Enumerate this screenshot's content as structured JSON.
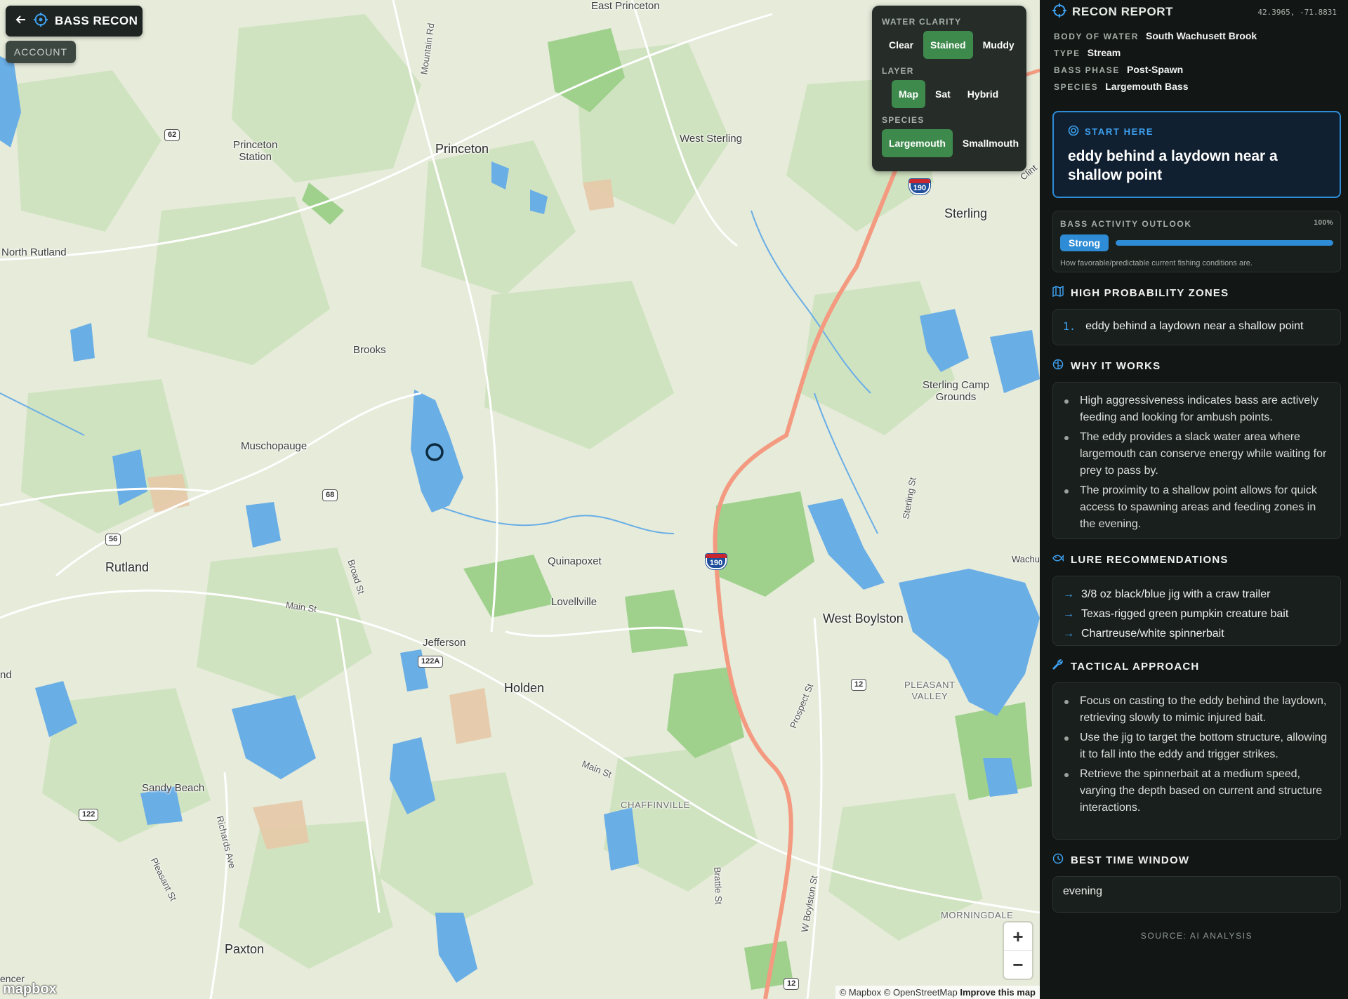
{
  "app": {
    "brand": "BASS RECON",
    "account_label": "ACCOUNT"
  },
  "filters": {
    "water_clarity": {
      "title": "WATER CLARITY",
      "options": [
        "Clear",
        "Stained",
        "Muddy"
      ],
      "selected": "Stained"
    },
    "layer": {
      "title": "LAYER",
      "options": [
        "Map",
        "Sat",
        "Hybrid"
      ],
      "selected": "Map"
    },
    "species": {
      "title": "SPECIES",
      "options": [
        "Largemouth",
        "Smallmouth"
      ],
      "selected": "Largemouth"
    }
  },
  "map": {
    "places": {
      "east_princeton": "East Princeton",
      "princeton_station": "Princeton\nStation",
      "princeton": "Princeton",
      "west_sterling": "West Sterling",
      "sterling": "Sterling",
      "north_rutland": "North Rutland",
      "brooks": "Brooks",
      "muschopauge": "Muschopauge",
      "sterling_camp_grounds": "Sterling Camp\nGrounds",
      "rutland": "Rutland",
      "quinapoxet": "Quinapoxet",
      "lovellville": "Lovellville",
      "jefferson": "Jefferson",
      "holden": "Holden",
      "west_boylston": "West Boylston",
      "pleasant_valley": "PLEASANT\nVALLEY",
      "chaffinville": "CHAFFINVILLE",
      "sandy_beach": "Sandy Beach",
      "morningdale": "MORNINGDALE",
      "paxton": "Paxton",
      "wachu": "Wachu",
      "clint": "Clint",
      "nd": "nd",
      "encer": "encer"
    },
    "roads": {
      "mountain_rd": "Mountain Rd",
      "main_st_1": "Main St",
      "main_st_2": "Main St",
      "broad_st": "Broad St",
      "sterling_st": "Sterling St",
      "prospect_st": "Prospect St",
      "richards_ave": "Richards Ave",
      "pleasant_st": "Pleasant St",
      "brattle_st": "Brattle St",
      "w_boylston_st": "W Boylston St"
    },
    "shields": {
      "r62": "62",
      "r68": "68",
      "r56": "56",
      "r122a": "122A",
      "r122": "122",
      "r12a": "12",
      "r12b": "12",
      "i190a": "190",
      "i190b": "190"
    },
    "zoom_in": "+",
    "zoom_out": "−",
    "logo": "mapbox",
    "attribution": "© Mapbox © OpenStreetMap",
    "improve": "Improve this map"
  },
  "report": {
    "title": "RECON REPORT",
    "coords": "42.3965, -71.8831",
    "meta": [
      {
        "k": "BODY OF WATER",
        "v": "South Wachusett Brook"
      },
      {
        "k": "TYPE",
        "v": "Stream"
      },
      {
        "k": "BASS PHASE",
        "v": "Post-Spawn"
      },
      {
        "k": "SPECIES",
        "v": "Largemouth Bass"
      }
    ],
    "start_here": {
      "label": "START HERE",
      "text": "eddy behind a laydown near a shallow point"
    },
    "outlook": {
      "label": "BASS ACTIVITY OUTLOOK",
      "percent_text": "100%",
      "level": 1.0,
      "rating": "Strong",
      "note": "How favorable/predictable current fishing conditions are."
    },
    "zones": {
      "title": "HIGH PROBABILITY ZONES",
      "items": [
        {
          "n": "1.",
          "text": "eddy behind a laydown near a shallow point"
        }
      ]
    },
    "why": {
      "title": "WHY IT WORKS",
      "items": [
        "High aggressiveness indicates bass are actively feeding and looking for ambush points.",
        "The eddy provides a slack water area where largemouth can conserve energy while waiting for prey to pass by.",
        "The proximity to a shallow point allows for quick access to spawning areas and feeding zones in the evening."
      ]
    },
    "lures": {
      "title": "LURE RECOMMENDATIONS",
      "arrow": "→",
      "items": [
        "3/8 oz black/blue jig with a craw trailer",
        "Texas-rigged green pumpkin creature bait",
        "Chartreuse/white spinnerbait"
      ]
    },
    "tactics": {
      "title": "TACTICAL APPROACH",
      "items": [
        "Focus on casting to the eddy behind the laydown, retrieving slowly to mimic injured bait.",
        "Use the jig to target the bottom structure, allowing it to fall into the eddy and trigger strikes.",
        "Retrieve the spinnerbait at a medium speed, varying the depth based on current and structure interactions."
      ]
    },
    "best_time": {
      "title": "BEST TIME WINDOW",
      "value": "evening"
    },
    "source": "SOURCE: AI ANALYSIS"
  },
  "colors": {
    "accent": "#2e8cd6",
    "active_toggle": "#3e8a4c",
    "water": "#6aaee6",
    "forest": "#a9d69a",
    "highway": "#f39a80",
    "panel_bg": "#121614"
  }
}
